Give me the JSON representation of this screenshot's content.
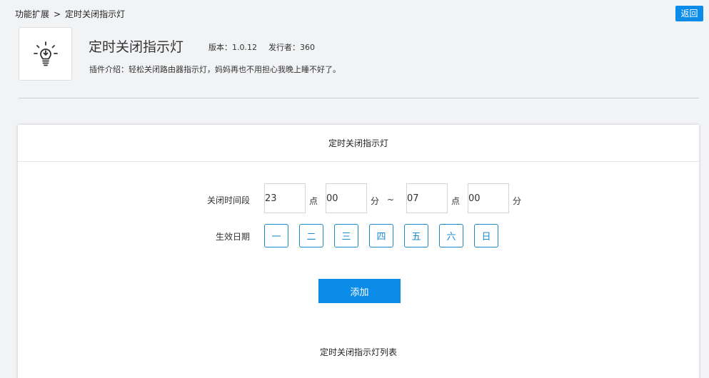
{
  "breadcrumb": {
    "parent": "功能扩展",
    "separator": ">",
    "current": "定时关闭指示灯"
  },
  "back_button": "返回",
  "plugin": {
    "icon": "lightbulb-icon",
    "title": "定时关闭指示灯",
    "version_label": "版本：1.0.12",
    "publisher_label": "发行者：360",
    "description": "插件介绍：轻松关闭路由器指示灯，妈妈再也不用担心我晚上睡不好了。"
  },
  "panel": {
    "title": "定时关闭指示灯",
    "time_range": {
      "label": "关闭时间段",
      "start_hour": "23",
      "start_minute": "00",
      "end_hour": "07",
      "end_minute": "00",
      "hour_unit": "点",
      "minute_unit": "分",
      "range_separator": "~"
    },
    "effective_days": {
      "label": "生效日期",
      "days": [
        "一",
        "二",
        "三",
        "四",
        "五",
        "六",
        "日"
      ]
    },
    "add_button": "添加",
    "list_title": "定时关闭指示灯列表"
  },
  "colors": {
    "accent": "#0c8ce9",
    "day_border": "#1a89c9",
    "background": "#f2f3f5"
  }
}
